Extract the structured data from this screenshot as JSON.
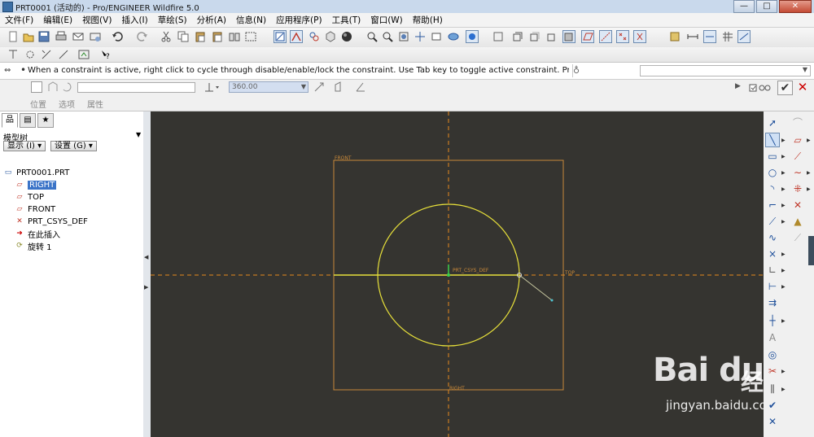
{
  "window": {
    "title": "PRT0001 (活动的) - Pro/ENGINEER Wildfire 5.0",
    "minimize": "—",
    "maximize": "□",
    "close": "✕"
  },
  "menubar": [
    "文件(F)",
    "编辑(E)",
    "视图(V)",
    "插入(I)",
    "草绘(S)",
    "分析(A)",
    "信息(N)",
    "应用程序(P)",
    "工具(T)",
    "窗口(W)",
    "帮助(H)"
  ],
  "message": {
    "text": "When a constraint is active, right click to cycle through disable/enable/lock the constraint. Use Tab key to toggle active constraint. Press and hold Shi"
  },
  "dashboard": {
    "angle_value": "360.00",
    "tabs": [
      "位置",
      "选项",
      "属性"
    ],
    "confirm": "✔",
    "cancel": "✕"
  },
  "model_tree": {
    "title": "模型树",
    "show_button": "显示 (I) ▾",
    "settings_button": "设置 (G) ▾",
    "items": [
      {
        "label": "PRT0001.PRT",
        "icon": "part-icon"
      },
      {
        "label": "RIGHT",
        "icon": "datum-plane-icon",
        "selected": true
      },
      {
        "label": "TOP",
        "icon": "datum-plane-icon"
      },
      {
        "label": "FRONT",
        "icon": "datum-plane-icon"
      },
      {
        "label": "PRT_CSYS_DEF",
        "icon": "csys-icon"
      },
      {
        "label": "在此插入",
        "icon": "insert-here-icon"
      },
      {
        "label": "旋转 1",
        "icon": "revolve-icon"
      }
    ]
  },
  "canvas": {
    "labels": {
      "front": "FRONT",
      "csys": "PRT_CSYS_DEF",
      "top": "TOP",
      "right": "RIGHT"
    },
    "colors": {
      "background": "#353430",
      "datum": "#c8893a",
      "sketch": "#e6df3a",
      "axis": "#e68a1e"
    }
  },
  "watermark": {
    "logo": "Bai du",
    "text": "经验",
    "url": "jingyan.baidu.com"
  }
}
